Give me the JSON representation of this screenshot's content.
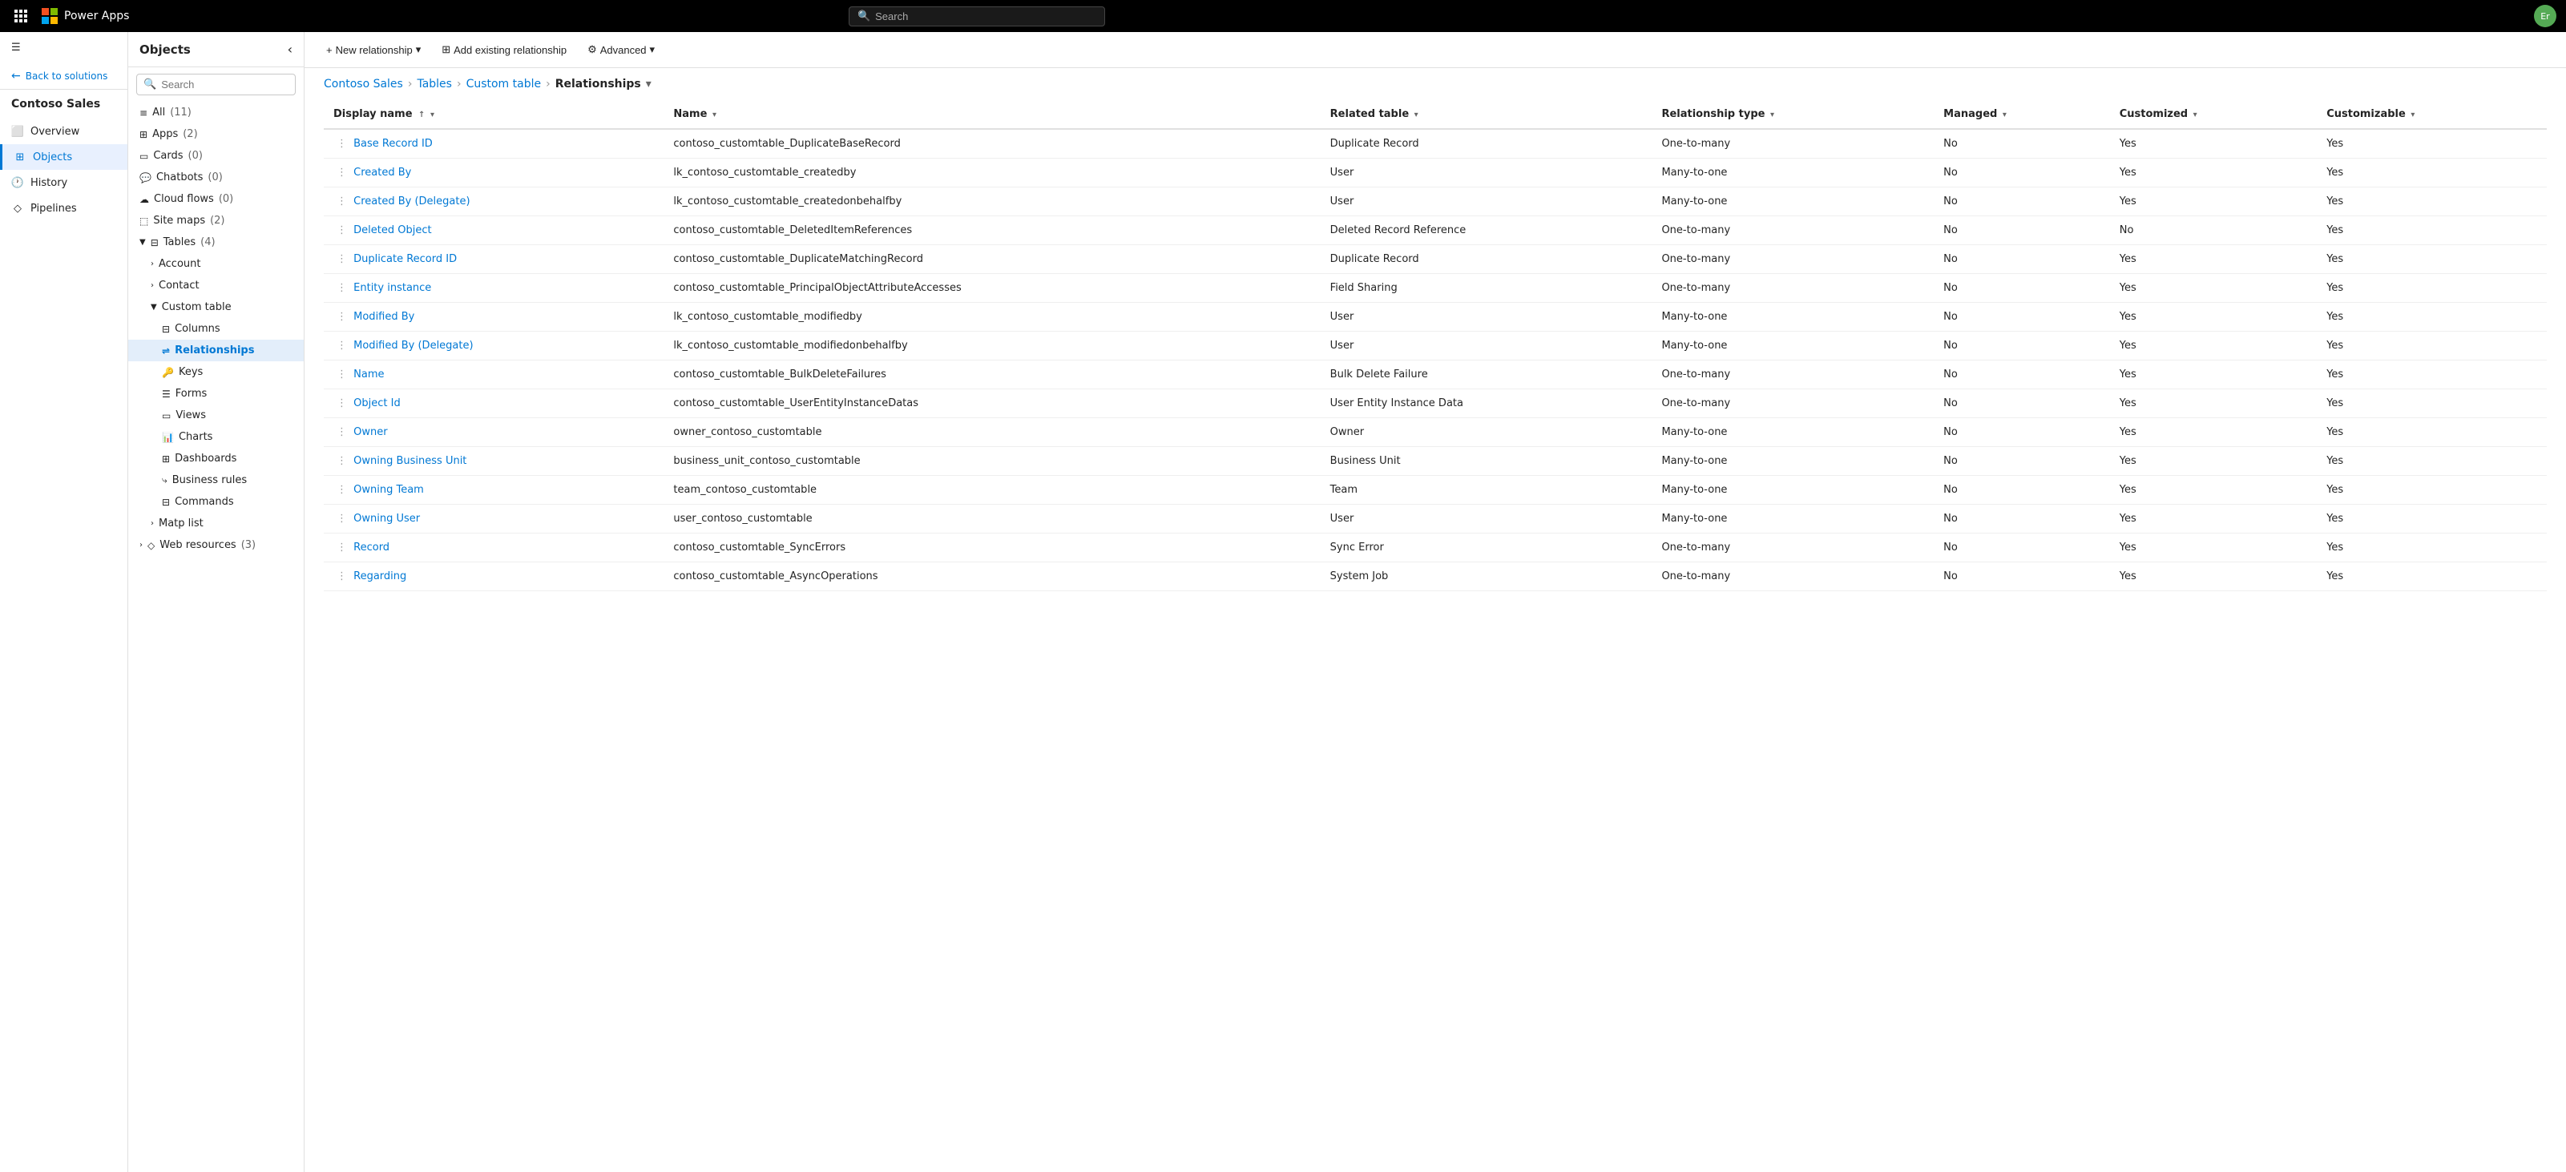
{
  "topnav": {
    "appname": "Power Apps",
    "search_placeholder": "Search"
  },
  "leftnav": {
    "back_label": "Back to solutions",
    "title": "Contoso Sales",
    "items": [
      {
        "id": "overview",
        "label": "Overview",
        "icon": "overview"
      },
      {
        "id": "objects",
        "label": "Objects",
        "icon": "objects",
        "active": true
      },
      {
        "id": "history",
        "label": "History",
        "icon": "history"
      },
      {
        "id": "pipelines",
        "label": "Pipelines",
        "icon": "pipelines"
      }
    ]
  },
  "sidebar": {
    "title": "Objects",
    "search_placeholder": "Search",
    "items": [
      {
        "id": "all",
        "label": "All",
        "count": "(11)",
        "indent": 0
      },
      {
        "id": "apps",
        "label": "Apps",
        "count": "(2)",
        "indent": 0
      },
      {
        "id": "cards",
        "label": "Cards",
        "count": "(0)",
        "indent": 0
      },
      {
        "id": "chatbots",
        "label": "Chatbots",
        "count": "(0)",
        "indent": 0
      },
      {
        "id": "cloud-flows",
        "label": "Cloud flows",
        "count": "(0)",
        "indent": 0
      },
      {
        "id": "site-maps",
        "label": "Site maps",
        "count": "(2)",
        "indent": 0
      },
      {
        "id": "tables",
        "label": "Tables",
        "count": "(4)",
        "indent": 0,
        "expanded": true,
        "hasChevron": true
      },
      {
        "id": "account",
        "label": "Account",
        "indent": 1,
        "hasChevron": true
      },
      {
        "id": "contact",
        "label": "Contact",
        "indent": 1,
        "hasChevron": true
      },
      {
        "id": "custom-table",
        "label": "Custom table",
        "indent": 1,
        "expanded": true,
        "hasChevron": true
      },
      {
        "id": "columns",
        "label": "Columns",
        "indent": 2
      },
      {
        "id": "relationships",
        "label": "Relationships",
        "indent": 2,
        "active": true
      },
      {
        "id": "keys",
        "label": "Keys",
        "indent": 2
      },
      {
        "id": "forms",
        "label": "Forms",
        "indent": 2
      },
      {
        "id": "views",
        "label": "Views",
        "indent": 2
      },
      {
        "id": "charts",
        "label": "Charts",
        "indent": 2
      },
      {
        "id": "dashboards",
        "label": "Dashboards",
        "indent": 2
      },
      {
        "id": "business-rules",
        "label": "Business rules",
        "indent": 2
      },
      {
        "id": "commands",
        "label": "Commands",
        "indent": 2
      },
      {
        "id": "matp-list",
        "label": "Matp list",
        "indent": 1,
        "hasChevron": true
      },
      {
        "id": "web-resources",
        "label": "Web resources",
        "count": "(3)",
        "indent": 0,
        "hasChevron": true
      }
    ]
  },
  "toolbar": {
    "new_relationship": "New relationship",
    "add_existing": "Add existing relationship",
    "advanced": "Advanced"
  },
  "breadcrumb": {
    "parts": [
      "Contoso Sales",
      "Tables",
      "Custom table",
      "Relationships"
    ]
  },
  "table": {
    "columns": [
      {
        "id": "display-name",
        "label": "Display name",
        "sortable": true,
        "hasDropdown": true
      },
      {
        "id": "name",
        "label": "Name",
        "sortable": false,
        "hasDropdown": true
      },
      {
        "id": "related-table",
        "label": "Related table",
        "sortable": false,
        "hasDropdown": true
      },
      {
        "id": "relationship-type",
        "label": "Relationship type",
        "sortable": false,
        "hasDropdown": true
      },
      {
        "id": "managed",
        "label": "Managed",
        "sortable": false,
        "hasDropdown": true
      },
      {
        "id": "customized",
        "label": "Customized",
        "sortable": false,
        "hasDropdown": true
      },
      {
        "id": "customizable",
        "label": "Customizable",
        "sortable": false,
        "hasDropdown": true
      }
    ],
    "rows": [
      {
        "display_name": "Base Record ID",
        "name": "contoso_customtable_DuplicateBaseRecord",
        "related_table": "Duplicate Record",
        "rel_type": "One-to-many",
        "managed": "No",
        "customized": "Yes",
        "customizable": "Yes"
      },
      {
        "display_name": "Created By",
        "name": "lk_contoso_customtable_createdby",
        "related_table": "User",
        "rel_type": "Many-to-one",
        "managed": "No",
        "customized": "Yes",
        "customizable": "Yes"
      },
      {
        "display_name": "Created By (Delegate)",
        "name": "lk_contoso_customtable_createdonbehalfby",
        "related_table": "User",
        "rel_type": "Many-to-one",
        "managed": "No",
        "customized": "Yes",
        "customizable": "Yes"
      },
      {
        "display_name": "Deleted Object",
        "name": "contoso_customtable_DeletedItemReferences",
        "related_table": "Deleted Record Reference",
        "rel_type": "One-to-many",
        "managed": "No",
        "customized": "No",
        "customizable": "Yes"
      },
      {
        "display_name": "Duplicate Record ID",
        "name": "contoso_customtable_DuplicateMatchingRecord",
        "related_table": "Duplicate Record",
        "rel_type": "One-to-many",
        "managed": "No",
        "customized": "Yes",
        "customizable": "Yes"
      },
      {
        "display_name": "Entity instance",
        "name": "contoso_customtable_PrincipalObjectAttributeAccesses",
        "related_table": "Field Sharing",
        "rel_type": "One-to-many",
        "managed": "No",
        "customized": "Yes",
        "customizable": "Yes"
      },
      {
        "display_name": "Modified By",
        "name": "lk_contoso_customtable_modifiedby",
        "related_table": "User",
        "rel_type": "Many-to-one",
        "managed": "No",
        "customized": "Yes",
        "customizable": "Yes"
      },
      {
        "display_name": "Modified By (Delegate)",
        "name": "lk_contoso_customtable_modifiedonbehalfby",
        "related_table": "User",
        "rel_type": "Many-to-one",
        "managed": "No",
        "customized": "Yes",
        "customizable": "Yes"
      },
      {
        "display_name": "Name",
        "name": "contoso_customtable_BulkDeleteFailures",
        "related_table": "Bulk Delete Failure",
        "rel_type": "One-to-many",
        "managed": "No",
        "customized": "Yes",
        "customizable": "Yes"
      },
      {
        "display_name": "Object Id",
        "name": "contoso_customtable_UserEntityInstanceDatas",
        "related_table": "User Entity Instance Data",
        "rel_type": "One-to-many",
        "managed": "No",
        "customized": "Yes",
        "customizable": "Yes"
      },
      {
        "display_name": "Owner",
        "name": "owner_contoso_customtable",
        "related_table": "Owner",
        "rel_type": "Many-to-one",
        "managed": "No",
        "customized": "Yes",
        "customizable": "Yes"
      },
      {
        "display_name": "Owning Business Unit",
        "name": "business_unit_contoso_customtable",
        "related_table": "Business Unit",
        "rel_type": "Many-to-one",
        "managed": "No",
        "customized": "Yes",
        "customizable": "Yes"
      },
      {
        "display_name": "Owning Team",
        "name": "team_contoso_customtable",
        "related_table": "Team",
        "rel_type": "Many-to-one",
        "managed": "No",
        "customized": "Yes",
        "customizable": "Yes"
      },
      {
        "display_name": "Owning User",
        "name": "user_contoso_customtable",
        "related_table": "User",
        "rel_type": "Many-to-one",
        "managed": "No",
        "customized": "Yes",
        "customizable": "Yes"
      },
      {
        "display_name": "Record",
        "name": "contoso_customtable_SyncErrors",
        "related_table": "Sync Error",
        "rel_type": "One-to-many",
        "managed": "No",
        "customized": "Yes",
        "customizable": "Yes"
      },
      {
        "display_name": "Regarding",
        "name": "contoso_customtable_AsyncOperations",
        "related_table": "System Job",
        "rel_type": "One-to-many",
        "managed": "No",
        "customized": "Yes",
        "customizable": "Yes"
      }
    ]
  }
}
